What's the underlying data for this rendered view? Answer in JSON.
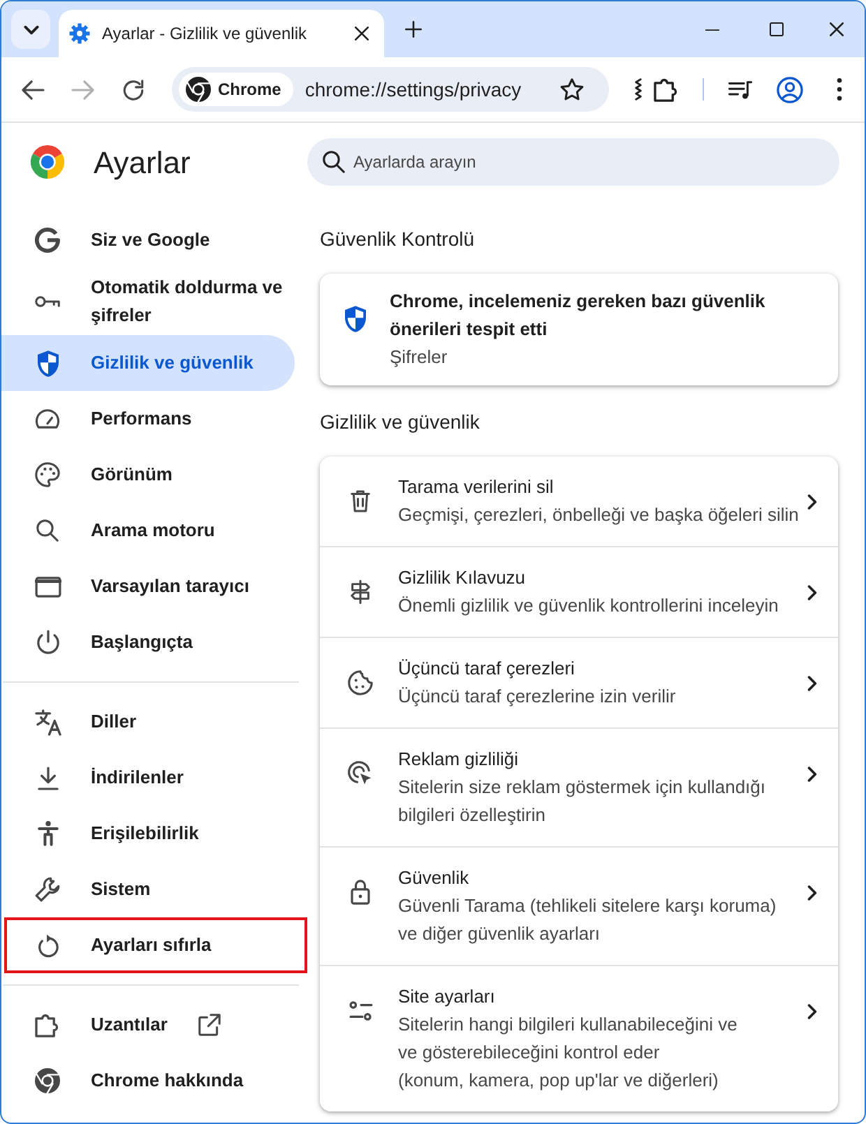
{
  "window": {
    "tabs": [
      {
        "title": "Ayarlar - Gizlilik ve güvenlik",
        "selected": true
      }
    ]
  },
  "toolbar": {
    "nav_buttons": [
      {
        "kind": "back",
        "disabled": false
      },
      {
        "kind": "forward",
        "disabled": true
      },
      {
        "kind": "reload",
        "disabled": false
      }
    ],
    "address_bar": {
      "chip": "Chrome",
      "url": "chrome://settings/privacy"
    }
  },
  "sidebar": {
    "title": "Ayarlar",
    "groups": [
      {
        "items": [
          {
            "kind": "google",
            "label": "Siz ve Google",
            "selected": false
          },
          {
            "kind": "key",
            "label": "Otomatik doldurma ve şifreler",
            "selected": false
          },
          {
            "kind": "shield",
            "label": "Gizlilik ve güvenlik",
            "selected": true
          },
          {
            "kind": "gauge",
            "label": "Performans",
            "selected": false
          },
          {
            "kind": "palette",
            "label": "Görünüm",
            "selected": false
          },
          {
            "kind": "search",
            "label": "Arama motoru",
            "selected": false
          },
          {
            "kind": "window",
            "label": "Varsayılan tarayıcı",
            "selected": false
          },
          {
            "kind": "power",
            "label": "Başlangıçta",
            "selected": false
          }
        ]
      },
      {
        "items": [
          {
            "kind": "translate",
            "label": "Diller",
            "selected": false
          },
          {
            "kind": "download",
            "label": "İndirilenler",
            "selected": false
          },
          {
            "kind": "accessibility",
            "label": "Erişilebilirlik",
            "selected": false
          },
          {
            "kind": "wrench",
            "label": "Sistem",
            "selected": false
          },
          {
            "kind": "reset",
            "label": "Ayarları sıfırla",
            "selected": false,
            "outlined": true
          }
        ]
      },
      {
        "items": [
          {
            "kind": "puzzle",
            "label": "Uzantılar",
            "selected": false,
            "external_link": true
          },
          {
            "kind": "chrome",
            "label": "Chrome hakkında",
            "selected": false
          }
        ]
      }
    ]
  },
  "search": {
    "placeholder": "Ayarlarda arayın"
  },
  "safety_check": {
    "heading": "Güvenlik Kontrolü",
    "card": {
      "title": "Chrome, incelemeniz gereken bazı güvenlik önerileri tespit etti",
      "subtitle": "Şifreler"
    }
  },
  "privacy": {
    "heading": "Gizlilik ve güvenlik",
    "rows": [
      {
        "kind": "trash",
        "title": "Tarama verilerini sil",
        "description": [
          "Geçmişi, çerezleri, önbelleği ve başka öğeleri silin"
        ]
      },
      {
        "kind": "signpost",
        "title": "Gizlilik Kılavuzu",
        "description": [
          "Önemli gizlilik ve güvenlik kontrollerini inceleyin"
        ]
      },
      {
        "kind": "cookie",
        "title": "Üçüncü taraf çerezleri",
        "description": [
          "Üçüncü taraf çerezlerine izin verilir"
        ]
      },
      {
        "kind": "cursor",
        "title": "Reklam gizliliği",
        "description": [
          "Sitelerin size reklam göstermek için kullandığı",
          "bilgileri özelleştirin"
        ]
      },
      {
        "kind": "lock",
        "title": "Güvenlik",
        "description": [
          "Güvenli Tarama (tehlikeli sitelere karşı koruma)",
          "ve diğer güvenlik ayarları"
        ]
      },
      {
        "kind": "sliders",
        "title": "Site ayarları",
        "description": [
          "Sitelerin hangi bilgileri kullanabileceğini ve",
          "ve gösterebileceğini kontrol eder",
          "(konum, kamera, pop up'lar ve diğerleri)"
        ]
      }
    ]
  }
}
